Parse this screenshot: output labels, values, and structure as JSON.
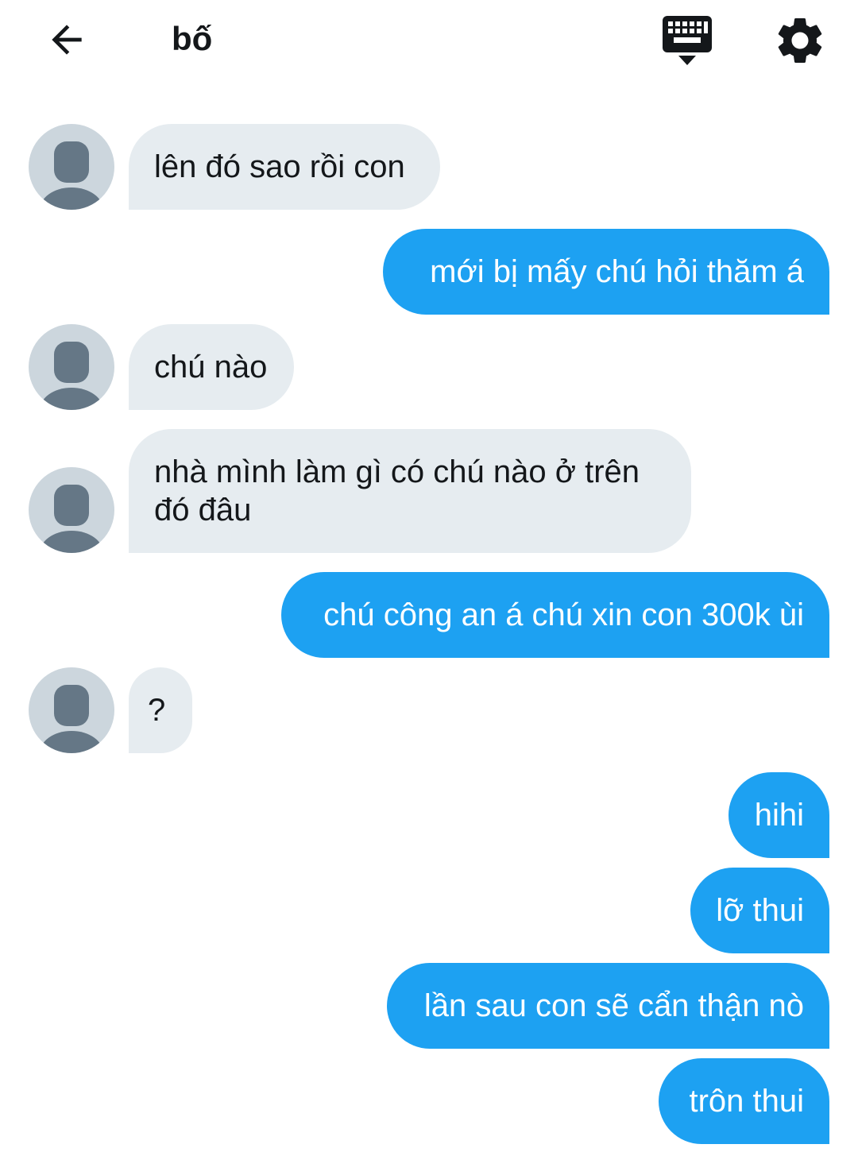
{
  "header": {
    "back_icon": "arrow-left-icon",
    "title": "bố",
    "keyboard_icon": "keyboard-icon",
    "settings_icon": "gear-icon"
  },
  "colors": {
    "incoming_bubble": "#e6ecf0",
    "outgoing_bubble": "#1da1f2",
    "avatar_bg": "#ccd6dd",
    "avatar_figure": "#657786"
  },
  "messages": [
    {
      "direction": "incoming",
      "text": "lên đó sao rồi con"
    },
    {
      "direction": "outgoing",
      "text": "mới bị mấy chú hỏi thăm á"
    },
    {
      "direction": "incoming",
      "text": "chú nào"
    },
    {
      "direction": "incoming",
      "text": "nhà mình làm gì có chú nào ở trên đó đâu"
    },
    {
      "direction": "outgoing",
      "text": "chú công an á chú xin con 300k ùi"
    },
    {
      "direction": "incoming",
      "text": "?"
    },
    {
      "direction": "outgoing",
      "text": "hihi"
    },
    {
      "direction": "outgoing",
      "text": "lỡ thui"
    },
    {
      "direction": "outgoing",
      "text": "lần sau con sẽ cẩn thận nò"
    },
    {
      "direction": "outgoing",
      "text": "trôn thui"
    }
  ]
}
